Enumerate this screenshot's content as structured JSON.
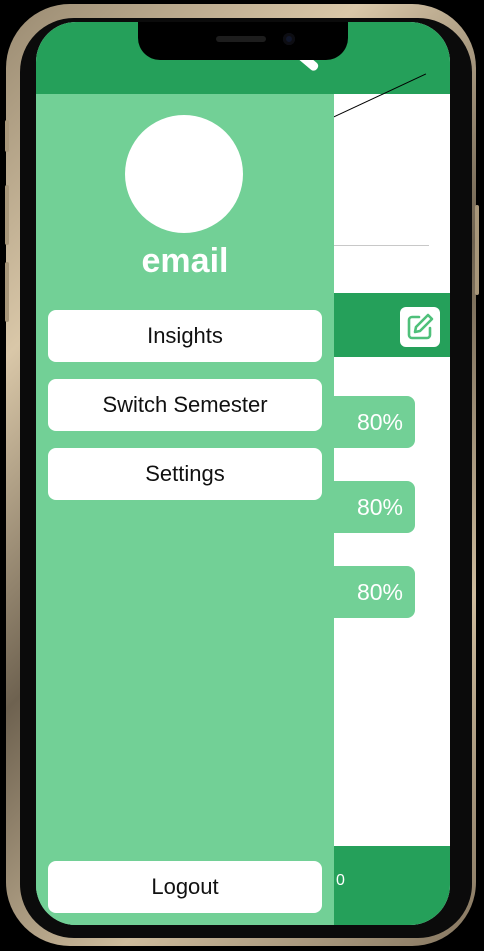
{
  "drawer": {
    "username": "email",
    "menu": [
      {
        "label": "Insights"
      },
      {
        "label": "Switch Semester"
      },
      {
        "label": "Settings"
      }
    ],
    "logout_label": "Logout"
  },
  "background": {
    "grades": [
      "80%",
      "80%",
      "80%"
    ],
    "bottom_text": "0"
  },
  "icons": {
    "header": "pencil-icon",
    "edit": "edit-square-icon",
    "avatar": "profile-avatar"
  },
  "colors": {
    "primary_green": "#25a05a",
    "drawer_green": "#72d096",
    "button_white": "#ffffff"
  }
}
